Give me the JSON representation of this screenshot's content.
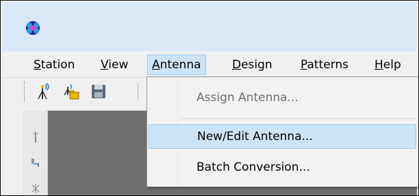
{
  "menubar": {
    "items": [
      {
        "label": "Station",
        "mnemonic": "S",
        "rest": "tation"
      },
      {
        "label": "View",
        "mnemonic": "V",
        "rest": "iew"
      },
      {
        "label": "Antenna",
        "mnemonic": "A",
        "rest": "ntenna"
      },
      {
        "label": "Design",
        "mnemonic": "D",
        "rest": "esign"
      },
      {
        "label": "Patterns",
        "mnemonic": "P",
        "rest": "atterns"
      },
      {
        "label": "Help",
        "mnemonic": "H",
        "rest": "elp"
      }
    ]
  },
  "antenna_menu": {
    "items": [
      {
        "label": "Assign Antenna...",
        "state": "disabled"
      },
      {
        "label": "New/Edit Antenna...",
        "state": "highlighted"
      },
      {
        "label": "Batch Conversion...",
        "state": "enabled"
      }
    ]
  },
  "toolbar": {
    "icons": [
      "antenna-signal-icon",
      "antenna-open-icon",
      "save-icon"
    ]
  },
  "colors": {
    "titlebar": "#d9e7f6",
    "menu_highlight": "#cce4f7",
    "workspace": "#6f6f6f"
  }
}
